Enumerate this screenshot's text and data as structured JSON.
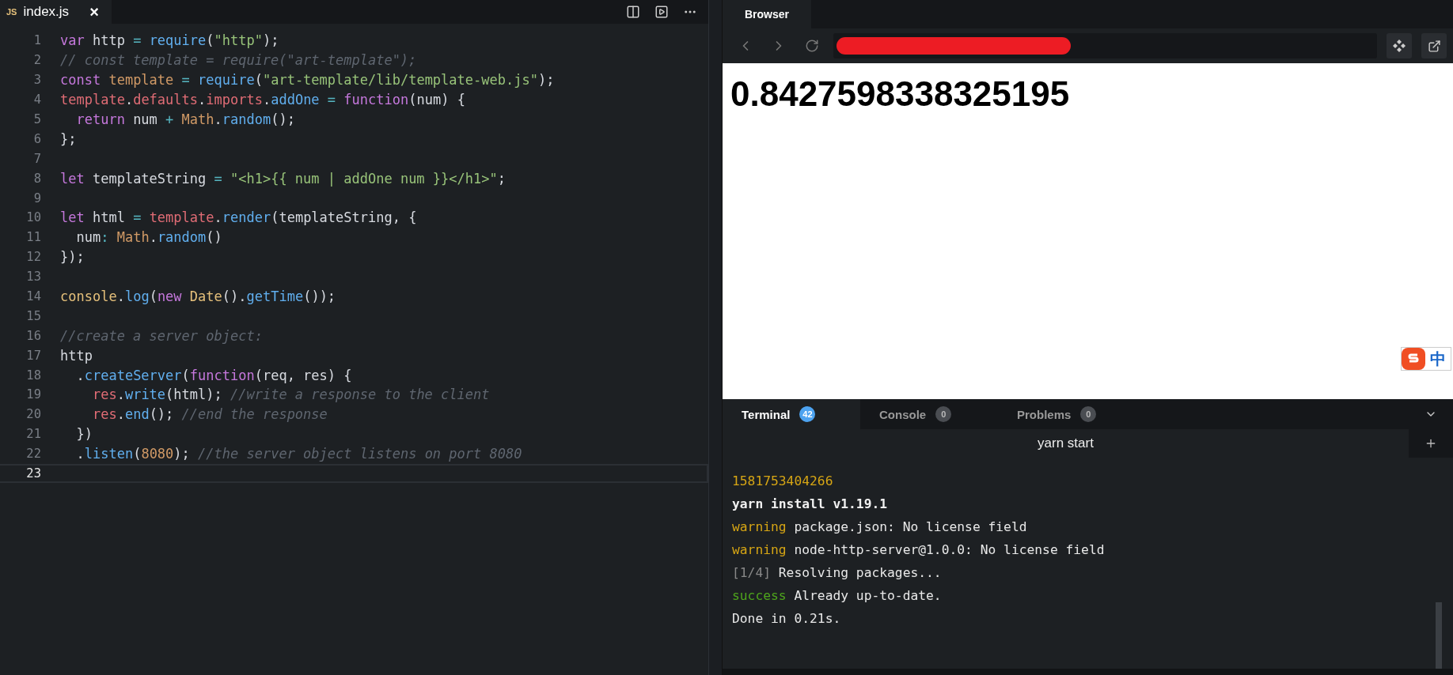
{
  "editor": {
    "tab": {
      "icon_label": "JS",
      "title": "index.js",
      "close": "×",
      "selected": true
    },
    "lines": [
      {
        "number": "1",
        "active": false,
        "tokens": [
          {
            "kind": "kw",
            "text": "var"
          },
          {
            "kind": "plain",
            "text": " http"
          },
          {
            "kind": "op",
            "text": " = "
          },
          {
            "kind": "fn",
            "text": "require"
          },
          {
            "kind": "plain",
            "text": "("
          },
          {
            "kind": "str",
            "text": "\"http\""
          },
          {
            "kind": "plain",
            "text": ");"
          }
        ]
      },
      {
        "number": "2",
        "active": false,
        "tokens": [
          {
            "kind": "comment",
            "text": "// const template = require(\"art-template\");"
          }
        ]
      },
      {
        "number": "3",
        "active": false,
        "tokens": [
          {
            "kind": "kw",
            "text": "const"
          },
          {
            "kind": "num",
            "text": " template"
          },
          {
            "kind": "op",
            "text": " = "
          },
          {
            "kind": "fn",
            "text": "require"
          },
          {
            "kind": "plain",
            "text": "("
          },
          {
            "kind": "str",
            "text": "\"art-template/lib/template-web.js\""
          },
          {
            "kind": "plain",
            "text": ");"
          }
        ]
      },
      {
        "number": "4",
        "active": false,
        "tokens": [
          {
            "kind": "var",
            "text": "template"
          },
          {
            "kind": "plain",
            "text": "."
          },
          {
            "kind": "var",
            "text": "defaults"
          },
          {
            "kind": "plain",
            "text": "."
          },
          {
            "kind": "var",
            "text": "imports"
          },
          {
            "kind": "plain",
            "text": "."
          },
          {
            "kind": "fn",
            "text": "addOne"
          },
          {
            "kind": "op",
            "text": " = "
          },
          {
            "kind": "kw",
            "text": "function"
          },
          {
            "kind": "plain",
            "text": "(num) {"
          }
        ]
      },
      {
        "number": "5",
        "active": false,
        "tokens": [
          {
            "kind": "kw",
            "text": "  return"
          },
          {
            "kind": "plain",
            "text": " num"
          },
          {
            "kind": "op",
            "text": " + "
          },
          {
            "kind": "num",
            "text": "Math"
          },
          {
            "kind": "plain",
            "text": "."
          },
          {
            "kind": "fn",
            "text": "random"
          },
          {
            "kind": "plain",
            "text": "();"
          }
        ]
      },
      {
        "number": "6",
        "active": false,
        "tokens": [
          {
            "kind": "plain",
            "text": "};"
          }
        ]
      },
      {
        "number": "7",
        "active": false
      },
      {
        "number": "8",
        "active": false,
        "tokens": [
          {
            "kind": "kw",
            "text": "let"
          },
          {
            "kind": "plain",
            "text": " templateString"
          },
          {
            "kind": "op",
            "text": " = "
          },
          {
            "kind": "str",
            "text": "\"<h1>{{ num | addOne num }}</h1>\""
          },
          {
            "kind": "plain",
            "text": ";"
          }
        ]
      },
      {
        "number": "9",
        "active": false
      },
      {
        "number": "10",
        "active": false,
        "tokens": [
          {
            "kind": "kw",
            "text": "let"
          },
          {
            "kind": "plain",
            "text": " html"
          },
          {
            "kind": "op",
            "text": " = "
          },
          {
            "kind": "var",
            "text": "template"
          },
          {
            "kind": "plain",
            "text": "."
          },
          {
            "kind": "fn",
            "text": "render"
          },
          {
            "kind": "plain",
            "text": "(templateString, {"
          }
        ]
      },
      {
        "number": "11",
        "active": false,
        "tokens": [
          {
            "kind": "plain",
            "text": "  num"
          },
          {
            "kind": "op",
            "text": ":"
          },
          {
            "kind": "num",
            "text": " Math"
          },
          {
            "kind": "plain",
            "text": "."
          },
          {
            "kind": "fn",
            "text": "random"
          },
          {
            "kind": "plain",
            "text": "()"
          }
        ]
      },
      {
        "number": "12",
        "active": false,
        "tokens": [
          {
            "kind": "plain",
            "text": "});"
          }
        ]
      },
      {
        "number": "13",
        "active": false
      },
      {
        "number": "14",
        "active": false,
        "tokens": [
          {
            "kind": "cls",
            "text": "console"
          },
          {
            "kind": "plain",
            "text": "."
          },
          {
            "kind": "fn",
            "text": "log"
          },
          {
            "kind": "plain",
            "text": "("
          },
          {
            "kind": "kw",
            "text": "new"
          },
          {
            "kind": "cls",
            "text": " Date"
          },
          {
            "kind": "plain",
            "text": "()."
          },
          {
            "kind": "fn",
            "text": "getTime"
          },
          {
            "kind": "plain",
            "text": "());"
          }
        ]
      },
      {
        "number": "15",
        "active": false
      },
      {
        "number": "16",
        "active": false,
        "tokens": [
          {
            "kind": "comment",
            "text": "//create a server object:"
          }
        ]
      },
      {
        "number": "17",
        "active": false,
        "tokens": [
          {
            "kind": "plain",
            "text": "http"
          }
        ]
      },
      {
        "number": "18",
        "active": false,
        "tokens": [
          {
            "kind": "plain",
            "text": "  ."
          },
          {
            "kind": "fn",
            "text": "createServer"
          },
          {
            "kind": "plain",
            "text": "("
          },
          {
            "kind": "kw",
            "text": "function"
          },
          {
            "kind": "plain",
            "text": "(req, res) {"
          }
        ]
      },
      {
        "number": "19",
        "active": false,
        "tokens": [
          {
            "kind": "var",
            "text": "    res"
          },
          {
            "kind": "plain",
            "text": "."
          },
          {
            "kind": "fn",
            "text": "write"
          },
          {
            "kind": "plain",
            "text": "(html);"
          },
          {
            "kind": "comment",
            "text": " //write a response to the client"
          }
        ]
      },
      {
        "number": "20",
        "active": false,
        "tokens": [
          {
            "kind": "var",
            "text": "    res"
          },
          {
            "kind": "plain",
            "text": "."
          },
          {
            "kind": "fn",
            "text": "end"
          },
          {
            "kind": "plain",
            "text": "();"
          },
          {
            "kind": "comment",
            "text": " //end the response"
          }
        ]
      },
      {
        "number": "21",
        "active": false,
        "tokens": [
          {
            "kind": "plain",
            "text": "  })"
          }
        ]
      },
      {
        "number": "22",
        "active": false,
        "tokens": [
          {
            "kind": "plain",
            "text": "  ."
          },
          {
            "kind": "fn",
            "text": "listen"
          },
          {
            "kind": "plain",
            "text": "("
          },
          {
            "kind": "num",
            "text": "8080"
          },
          {
            "kind": "plain",
            "text": ");"
          },
          {
            "kind": "comment",
            "text": " //the server object listens on port 8080"
          }
        ]
      },
      {
        "number": "23",
        "active": true
      }
    ]
  },
  "browser": {
    "tab": {
      "title": "Browser",
      "selected": true
    },
    "address_redacted": true,
    "content": "0.8427598338325195",
    "ime_indicator": "中"
  },
  "panel": {
    "tabs": [
      {
        "label": "Terminal",
        "count": "42",
        "selected": true
      },
      {
        "label": "Console",
        "count": "0",
        "selected": false
      },
      {
        "label": "Problems",
        "count": "0",
        "selected": false
      }
    ],
    "terminal_title": "yarn start",
    "output": [
      {
        "tokens": [
          {
            "kind": "number",
            "text": "1581753404266"
          }
        ]
      },
      {
        "tokens": [
          {
            "kind": "bold",
            "text": "yarn install v1.19.1"
          }
        ]
      },
      {
        "tokens": [
          {
            "kind": "warning",
            "text": "warning"
          },
          {
            "kind": "plain",
            "text": " package.json: No license field"
          }
        ]
      },
      {
        "tokens": [
          {
            "kind": "warning",
            "text": "warning"
          },
          {
            "kind": "plain",
            "text": " node-http-server@1.0.0: No license field"
          }
        ]
      },
      {
        "tokens": [
          {
            "kind": "dim",
            "text": "[1/4]"
          },
          {
            "kind": "plain",
            "text": " Resolving packages..."
          }
        ]
      },
      {
        "tokens": [
          {
            "kind": "success",
            "text": "success"
          },
          {
            "kind": "plain",
            "text": " Already up-to-date."
          }
        ]
      },
      {
        "tokens": [
          {
            "kind": "plain",
            "text": "Done in 0.21s."
          }
        ]
      }
    ]
  }
}
